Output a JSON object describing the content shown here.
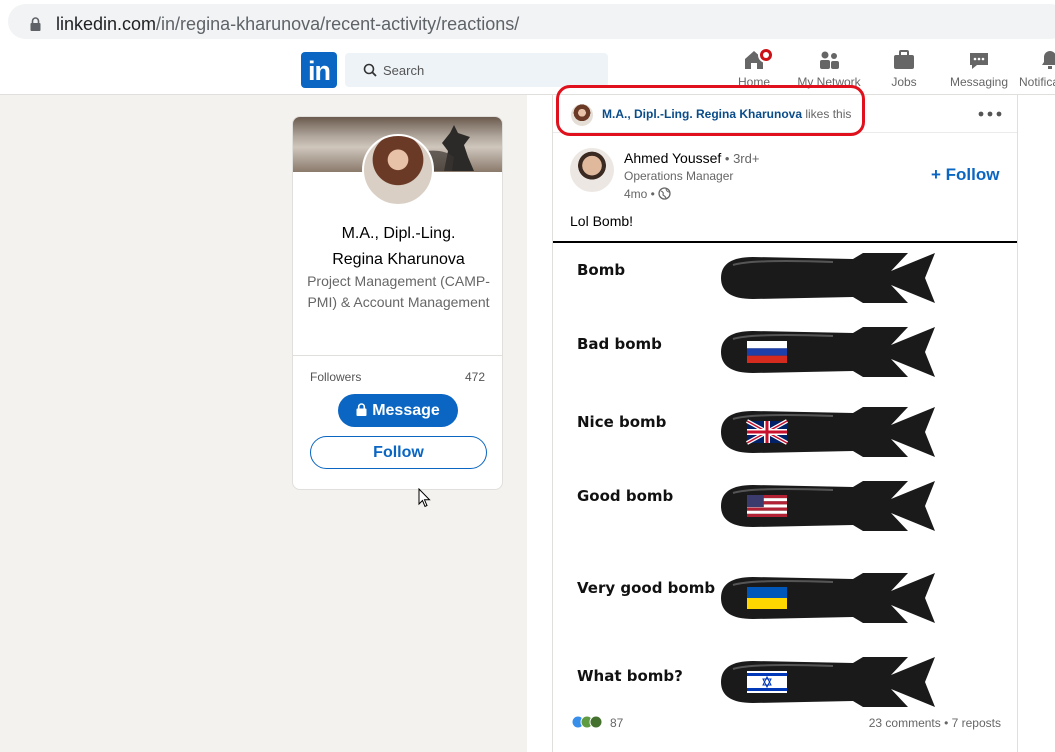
{
  "browser": {
    "url_host": "linkedin.com",
    "url_path": "/in/regina-kharunova/recent-activity/reactions/"
  },
  "nav": {
    "logo": "in",
    "search_placeholder": "Search",
    "items": [
      {
        "label": "Home",
        "icon": "home-icon"
      },
      {
        "label": "My Network",
        "icon": "network-icon"
      },
      {
        "label": "Jobs",
        "icon": "jobs-icon"
      },
      {
        "label": "Messaging",
        "icon": "messaging-icon"
      },
      {
        "label": "Notifications",
        "icon": "bell-icon"
      }
    ]
  },
  "profile": {
    "name_line1": "M.A., Dipl.-Ling.",
    "name_line2": "Regina Kharunova",
    "headline": "Project Management (CAMP-PMI) & Account Management",
    "followers_label": "Followers",
    "followers_count": "472",
    "message_label": "Message",
    "follow_label": "Follow"
  },
  "post": {
    "liker": "M.A., Dipl.-Ling. Regina Kharunova",
    "likes_suffix": " likes this",
    "author_name": "Ahmed Youssef",
    "author_degree": " • 3rd+",
    "author_title": "Operations Manager",
    "time": "4mo •",
    "follow_label": "+ Follow",
    "text": "Lol Bomb!",
    "image_rows": [
      {
        "label": "Bomb",
        "flag": "none"
      },
      {
        "label": "Bad bomb",
        "flag": "russia"
      },
      {
        "label": "Nice bomb",
        "flag": "uk"
      },
      {
        "label": "Good bomb",
        "flag": "usa"
      },
      {
        "label": "Very good bomb",
        "flag": "ukraine"
      },
      {
        "label": "What bomb?",
        "flag": "israel"
      }
    ],
    "reactions_count": "87",
    "stats": "23 comments • 7 reposts"
  },
  "colors": {
    "linkedin_blue": "#0a66c2",
    "highlight_red": "#e0101c",
    "page_bg": "#f3f2ef"
  }
}
